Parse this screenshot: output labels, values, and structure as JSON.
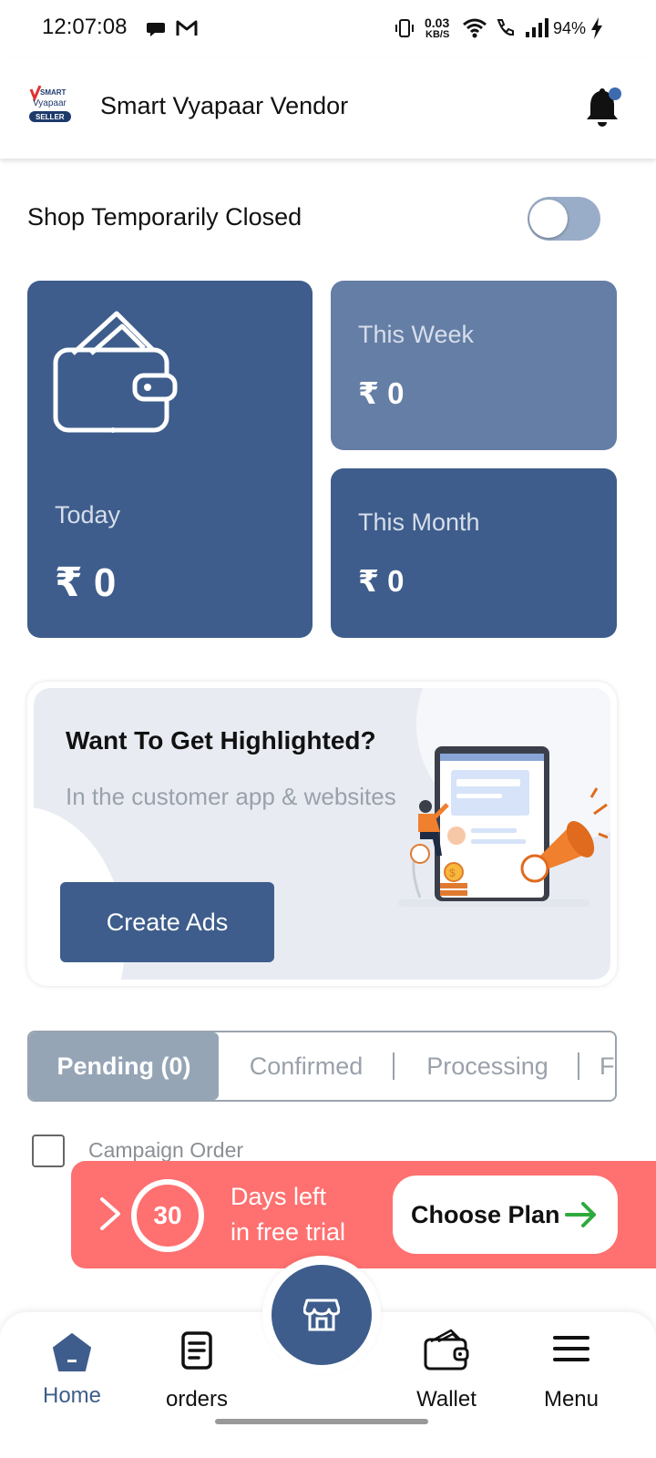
{
  "status_bar": {
    "time": "12:07:08",
    "net_speed_value": "0.03",
    "net_speed_unit": "KB/S",
    "battery": "94%"
  },
  "app_bar": {
    "title": "Smart Vyapaar Vendor",
    "logo_text_top": "SMART",
    "logo_text_mid": "Vyapaar",
    "logo_text_badge": "SELLER"
  },
  "shop_status": {
    "label": "Shop Temporarily Closed",
    "toggle_on": false
  },
  "stats": {
    "today": {
      "label": "Today",
      "value": "₹ 0"
    },
    "week": {
      "label": "This Week",
      "value": "₹ 0"
    },
    "month": {
      "label": "This Month",
      "value": "₹ 0"
    }
  },
  "promo": {
    "title": "Want To Get Highlighted?",
    "subtitle": "In the customer app & websites",
    "button": "Create Ads"
  },
  "order_tabs": [
    {
      "label": "Pending (0)",
      "active": true
    },
    {
      "label": "Confirmed",
      "active": false
    },
    {
      "label": "Processing",
      "active": false
    },
    {
      "label": "F",
      "active": false
    }
  ],
  "campaign_filter": {
    "label": "Campaign Order",
    "checked": false
  },
  "trial_banner": {
    "days": "30",
    "line1": "Days left",
    "line2": "in free trial",
    "button": "Choose Plan"
  },
  "bottom_nav": {
    "home": "Home",
    "orders": "orders",
    "wallet": "Wallet",
    "menu": "Menu"
  },
  "colors": {
    "primary": "#3e5d8c",
    "week_card": "#657ea5",
    "trial_red": "#ff7070",
    "tab_active": "#95a5b6",
    "accent_green": "#2eaa3c",
    "notification_dot": "#3e6bb0"
  }
}
